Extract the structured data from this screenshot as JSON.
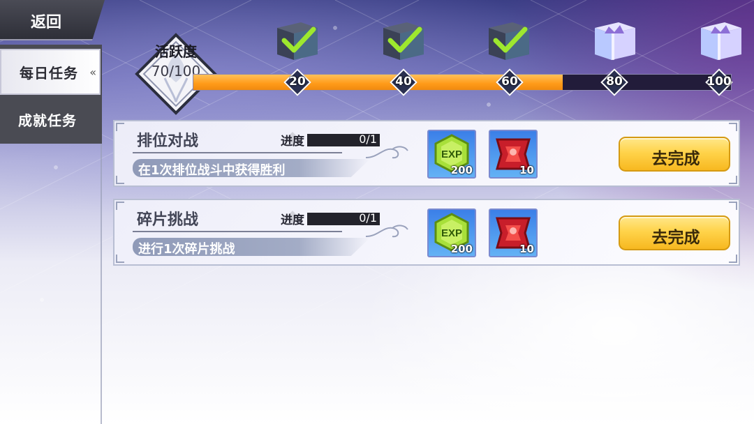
{
  "nav": {
    "back_label": "返回",
    "tabs": [
      {
        "label": "每日任务",
        "selected": true,
        "indicator": "«"
      },
      {
        "label": "成就任务",
        "selected": false
      }
    ]
  },
  "activity": {
    "title": "活跃度",
    "value_text": "70/100",
    "current": 70,
    "max": 100,
    "milestones": [
      {
        "label": "20",
        "value": 20,
        "claimed": true,
        "chest": "chest-claimed-icon"
      },
      {
        "label": "40",
        "value": 40,
        "claimed": true,
        "chest": "chest-claimed-icon"
      },
      {
        "label": "60",
        "value": 60,
        "claimed": true,
        "chest": "chest-claimed-icon"
      },
      {
        "label": "80",
        "value": 80,
        "claimed": false,
        "chest": "crystal-chest-icon"
      },
      {
        "label": "100",
        "value": 100,
        "claimed": false,
        "chest": "crystal-chest-icon"
      }
    ]
  },
  "tasks": [
    {
      "name": "排位对战",
      "progress_label": "进度",
      "progress_text": "0/1",
      "progress": 0,
      "description": "在1次排位战斗中获得胜利",
      "rewards": [
        {
          "icon": "exp-icon",
          "icon_text": "EXP",
          "count": "200"
        },
        {
          "icon": "red-crystal-icon",
          "count": "10"
        }
      ],
      "action_label": "去完成"
    },
    {
      "name": "碎片挑战",
      "progress_label": "进度",
      "progress_text": "0/1",
      "progress": 0,
      "description": "进行1次碎片挑战",
      "rewards": [
        {
          "icon": "exp-icon",
          "icon_text": "EXP",
          "count": "200"
        },
        {
          "icon": "red-crystal-icon",
          "count": "10"
        }
      ],
      "action_label": "去完成"
    }
  ],
  "colors": {
    "progress_fill": "#ff9a18",
    "progress_track": "#221c3a",
    "action_button": "#ffd34a",
    "reward_frame": "#3b7fe8"
  }
}
